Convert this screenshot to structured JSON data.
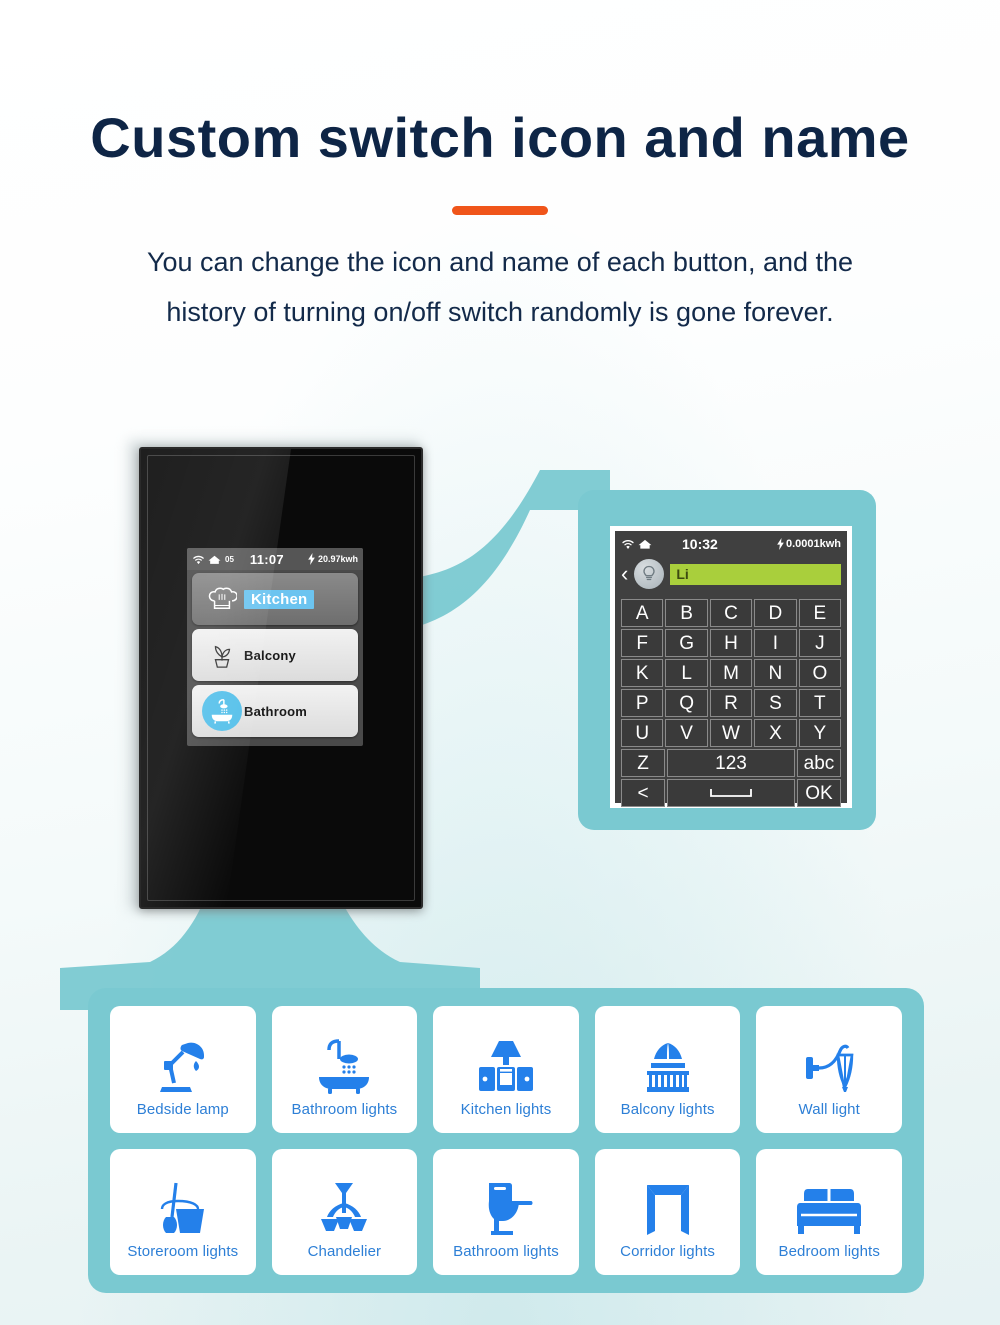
{
  "header": {
    "title": "Custom switch icon and name",
    "subtitle_line1": "You can change the icon and name of each button, and the",
    "subtitle_line2": "history of turning on/off switch randomly is gone forever.",
    "accent_color": "#f0551a"
  },
  "theme": {
    "teal": "#7ac9d1",
    "icon_blue": "#2d7fd6",
    "highlight_blue": "#6cc4f0",
    "field_green": "#a9cf3c",
    "title_color": "#0e2546"
  },
  "switch_panel": {
    "status": {
      "wifi_icon": "wifi-icon",
      "home_icon": "home-icon",
      "home_count": "05",
      "time": "11:07",
      "power_icon": "lightning-icon",
      "energy": "20.97kwh"
    },
    "buttons": [
      {
        "icon": "chef-hat-icon",
        "label": "Kitchen",
        "selected": true
      },
      {
        "icon": "potted-plant-icon",
        "label": "Balcony",
        "selected": false
      },
      {
        "icon": "bathtub-shower-icon",
        "label": "Bathroom",
        "selected": false
      }
    ]
  },
  "keyboard_screen": {
    "status": {
      "wifi_icon": "wifi-icon",
      "home_icon": "home-icon",
      "time": "10:32",
      "power_icon": "lightning-icon",
      "energy": "0.0001kwh"
    },
    "back_icon": "chevron-left-icon",
    "avatar_icon": "lightbulb-icon",
    "input_value": "Li",
    "key_rows": [
      [
        "A",
        "B",
        "C",
        "D",
        "E"
      ],
      [
        "F",
        "G",
        "H",
        "I",
        "J"
      ],
      [
        "K",
        "L",
        "M",
        "N",
        "O"
      ],
      [
        "P",
        "Q",
        "R",
        "S",
        "T"
      ],
      [
        "U",
        "V",
        "W",
        "X",
        "Y"
      ]
    ],
    "row_numeric": {
      "letter": "Z",
      "numbers": "123",
      "case": "abc"
    },
    "row_action": {
      "backspace": "<",
      "space": "space-bar-icon",
      "confirm": "OK"
    }
  },
  "icon_library": {
    "tiles": [
      {
        "icon": "desk-lamp-icon",
        "label": "Bedside lamp"
      },
      {
        "icon": "bathtub-shower-icon",
        "label": "Bathroom lights"
      },
      {
        "icon": "kitchen-range-icon",
        "label": "Kitchen lights"
      },
      {
        "icon": "balcony-awning-icon",
        "label": "Balcony lights"
      },
      {
        "icon": "wall-sconce-icon",
        "label": "Wall light"
      },
      {
        "icon": "mop-bucket-icon",
        "label": "Storeroom lights"
      },
      {
        "icon": "chandelier-icon",
        "label": "Chandelier"
      },
      {
        "icon": "toilet-icon",
        "label": "Bathroom lights"
      },
      {
        "icon": "doorway-icon",
        "label": "Corridor lights"
      },
      {
        "icon": "bed-icon",
        "label": "Bedroom lights"
      }
    ]
  }
}
